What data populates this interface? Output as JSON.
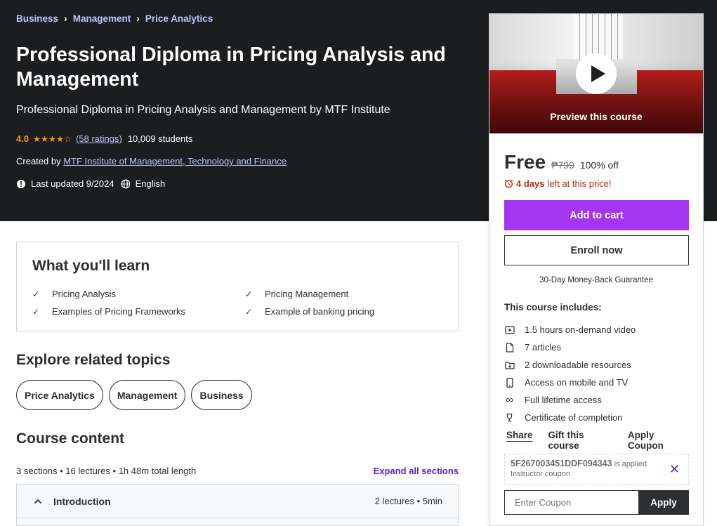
{
  "breadcrumbs": [
    "Business",
    "Management",
    "Price Analytics"
  ],
  "course": {
    "title": "Professional Diploma in Pricing Analysis and Management",
    "subtitle": "Professional Diploma in Pricing Analysis and Management by MTF Institute",
    "rating": "4.0",
    "rating_stars": 4,
    "ratings_count": "(58 ratings)",
    "students": "10,009 students",
    "created_by_label": "Created by",
    "instructor": "MTF Institute of Management, Technology and Finance",
    "last_updated": "Last updated 9/2024",
    "language": "English"
  },
  "learn": {
    "title": "What you'll learn",
    "items": [
      "Pricing Analysis",
      "Pricing Management",
      "Examples of Pricing Frameworks",
      "Example of banking pricing"
    ]
  },
  "related": {
    "title": "Explore related topics",
    "topics": [
      "Price Analytics",
      "Management",
      "Business"
    ]
  },
  "content": {
    "title": "Course content",
    "meta": "3 sections • 16 lectures • 1h 48m total length",
    "expand_label": "Expand all sections",
    "sections": [
      {
        "title": "Introduction",
        "meta": "2 lectures • 5min"
      }
    ]
  },
  "sidebar": {
    "preview_label": "Preview this course",
    "price": "Free",
    "original_price": "₱799",
    "discount": "100% off",
    "timer_bold": "4 days",
    "timer_rest": "left at this price!",
    "add_to_cart": "Add to cart",
    "enroll_now": "Enroll now",
    "guarantee": "30-Day Money-Back Guarantee",
    "includes_title": "This course includes:",
    "includes": [
      {
        "icon": "video-icon",
        "label": "1.5 hours on-demand video"
      },
      {
        "icon": "article-icon",
        "label": "7 articles"
      },
      {
        "icon": "download-icon",
        "label": "2 downloadable resources"
      },
      {
        "icon": "mobile-icon",
        "label": "Access on mobile and TV"
      },
      {
        "icon": "infinity-icon",
        "label": "Full lifetime access"
      },
      {
        "icon": "trophy-icon",
        "label": "Certificate of completion"
      }
    ],
    "share": "Share",
    "gift": "Gift this course",
    "apply_coupon": "Apply Coupon",
    "coupon_code": "5F267003451DDF094343",
    "coupon_applied": "is applied",
    "coupon_type": "Instructor coupon",
    "coupon_placeholder": "Enter Coupon",
    "coupon_apply_btn": "Apply"
  },
  "colors": {
    "hero_bg": "#1c1d1f",
    "accent_purple": "#a435f0",
    "link_purple": "#5624d0",
    "star_orange": "#f69c08",
    "timer_red": "#b32d0f"
  }
}
